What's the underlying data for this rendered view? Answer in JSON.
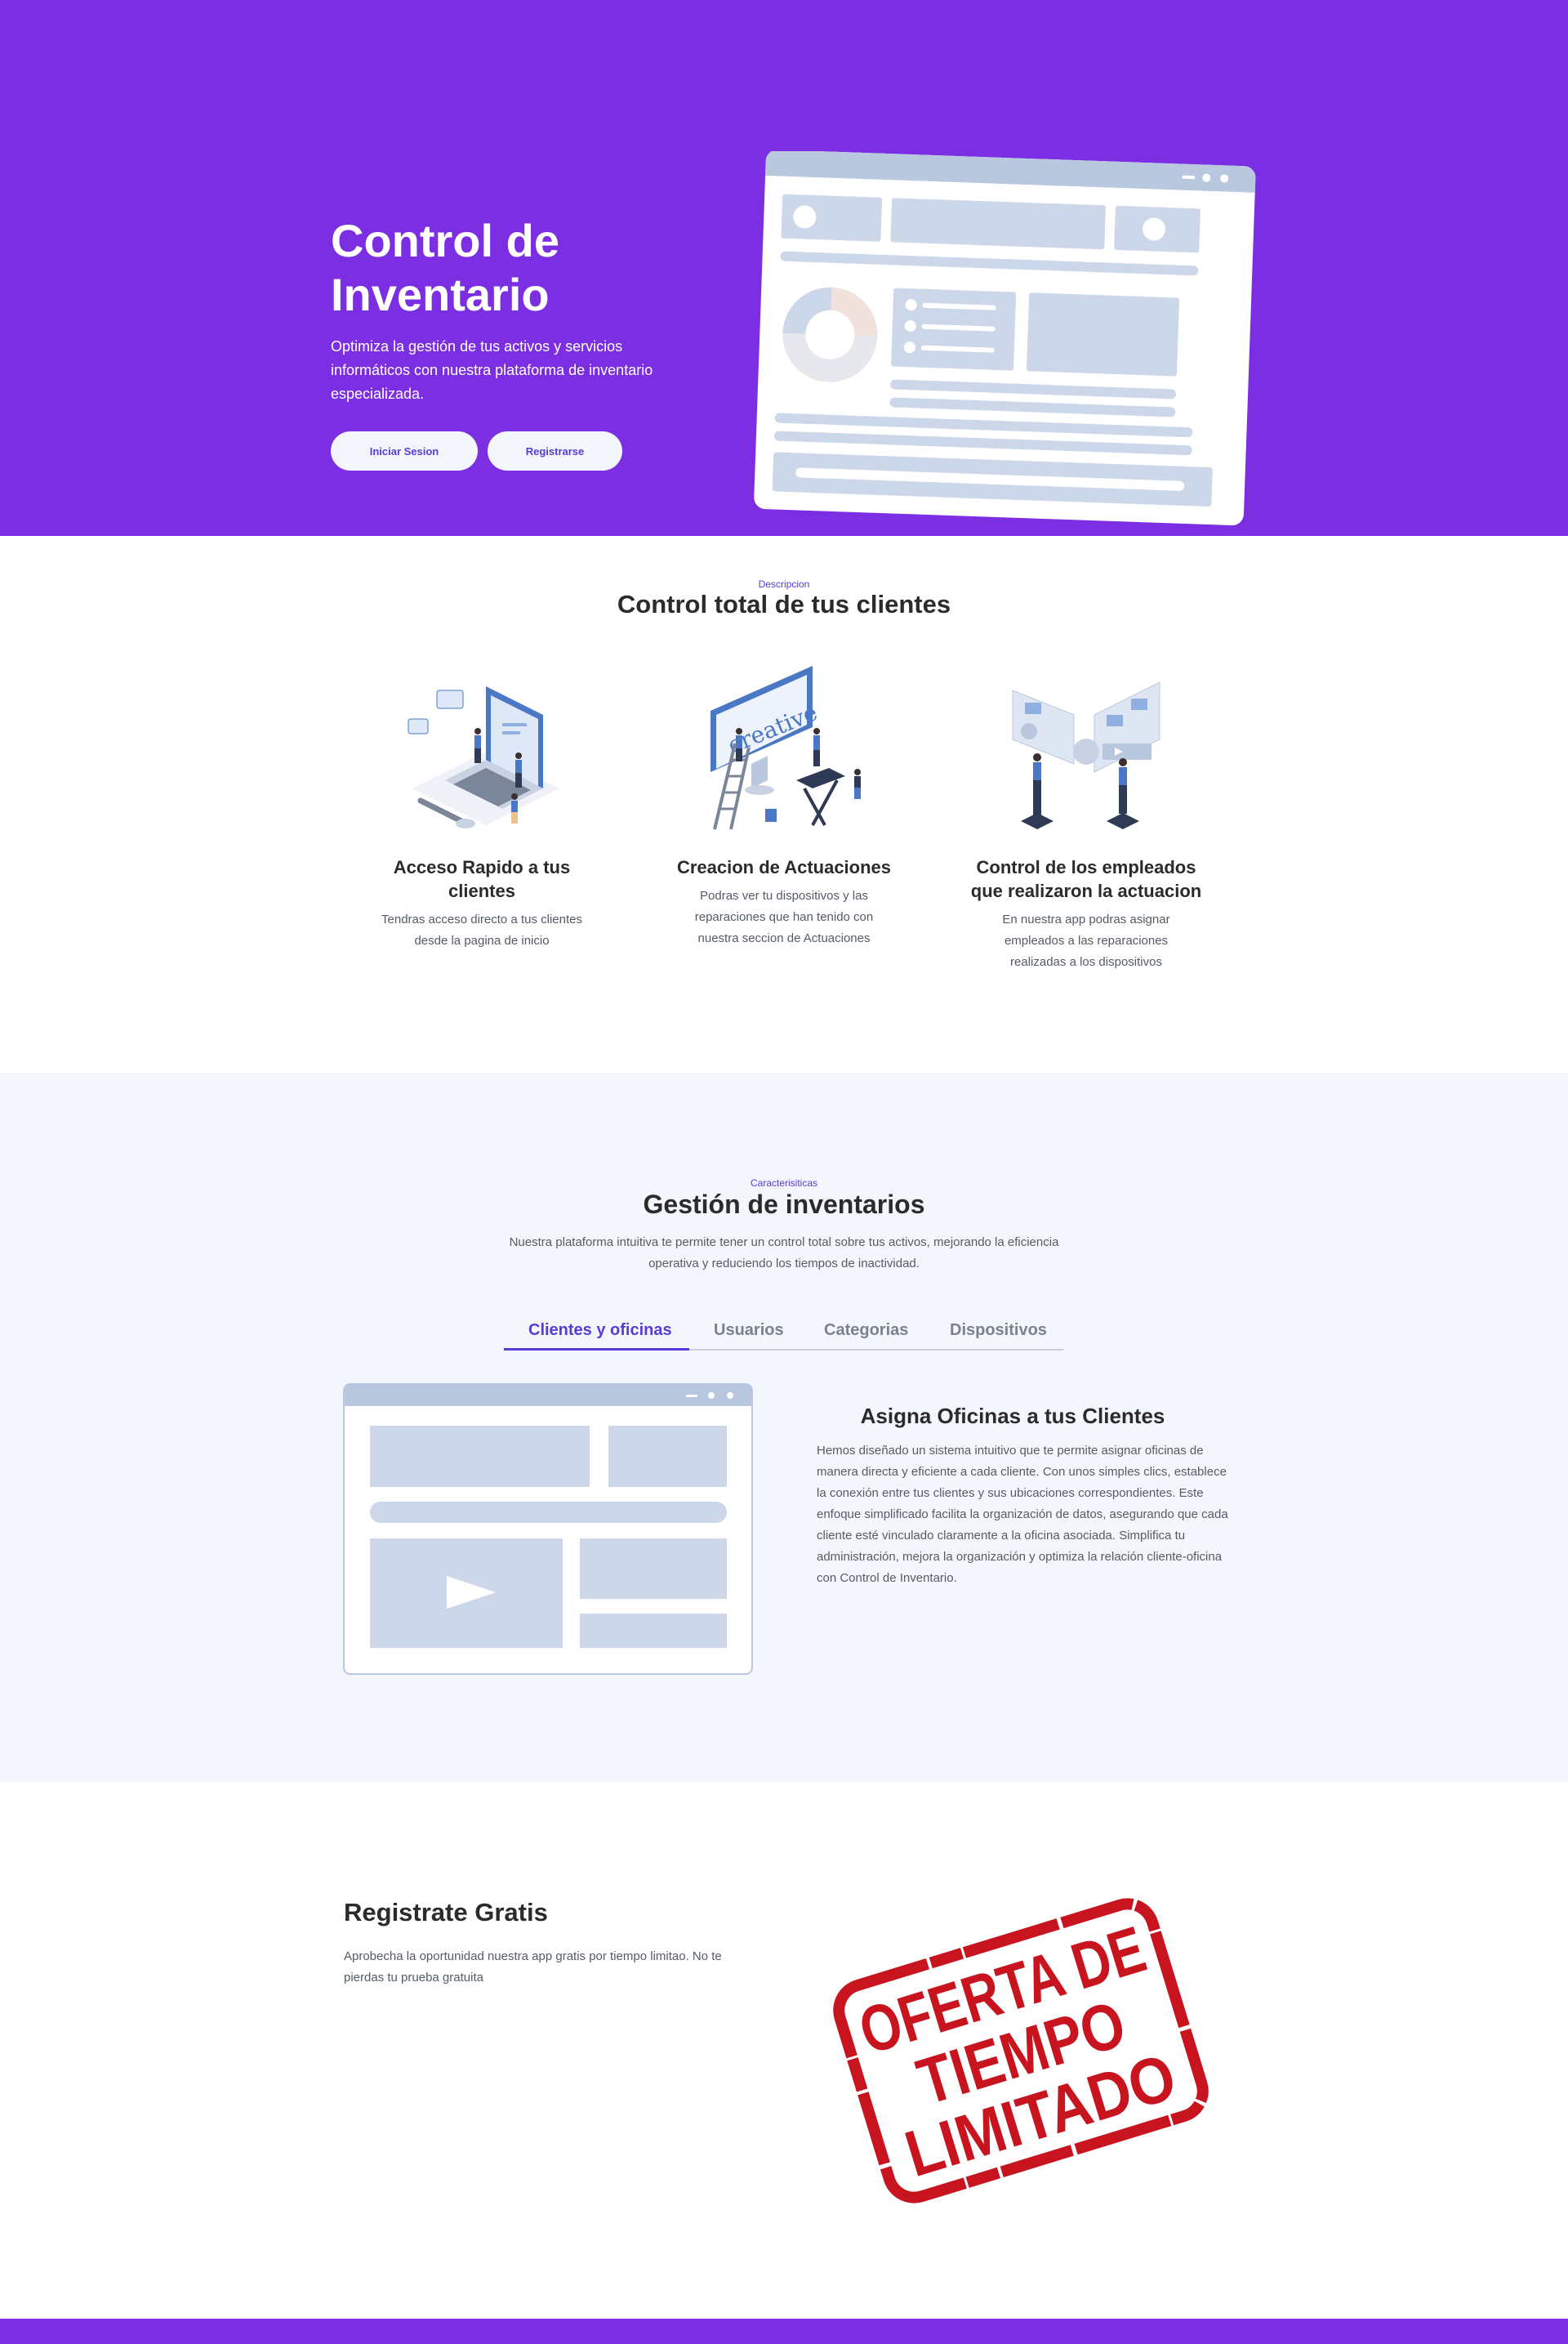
{
  "hero": {
    "title": "Control de Inventario",
    "subtitle": "Optimiza la gestión de tus activos y servicios informáticos con nuestra plataforma de inventario especializada.",
    "login_label": "Iniciar Sesion",
    "register_label": "Registrarse"
  },
  "description": {
    "eyebrow": "Descripcion",
    "title": "Control total de tus clientes",
    "cards": [
      {
        "title": "Acceso Rapido a tus clientes",
        "text": "Tendras acceso directo a tus clientes desde la pagina de inicio"
      },
      {
        "title": "Creacion de Actuaciones",
        "text": "Podras ver tu dispositivos y las reparaciones que han tenido con nuestra seccion de Actuaciones"
      },
      {
        "title": "Control de los empleados que realizaron la actuacion",
        "text": "En nuestra app podras asignar empleados a las reparaciones realizadas a los dispositivos"
      }
    ]
  },
  "features": {
    "eyebrow": "Caracterisiticas",
    "title": "Gestión de inventarios",
    "subtitle": "Nuestra plataforma intuitiva te permite tener un control total sobre tus activos, mejorando la eficiencia operativa y reduciendo los tiempos de inactividad.",
    "tabs": [
      "Clientes y oficinas",
      "Usuarios",
      "Categorias",
      "Dispositivos"
    ],
    "active_tab": "Clientes y oficinas",
    "panel_title": "Asigna Oficinas a tus Clientes",
    "panel_text": "Hemos diseñado un sistema intuitivo que te permite asignar oficinas de manera directa y eficiente a cada cliente. Con unos simples clics, establece la conexión entre tus clientes y sus ubicaciones correspondientes. Este enfoque simplificado facilita la organización de datos, asegurando que cada cliente esté vinculado claramente a la oficina asociada. Simplifica tu administración, mejora la organización y optimiza la relación cliente-oficina con Control de Inventario."
  },
  "register": {
    "title": "Registrate Gratis",
    "text": "Aprobecha la oportunidad nuestra app gratis por tiempo limitao. No te pierdas tu prueba gratuita",
    "stamp_lines": [
      "OFERTA DE",
      "TIEMPO",
      "LIMITADO"
    ]
  },
  "colors": {
    "brand_purple": "#7c2fe2",
    "accent": "#5a3ad6",
    "section_bg": "#f3f6fd",
    "stamp_red": "#c8141e"
  }
}
